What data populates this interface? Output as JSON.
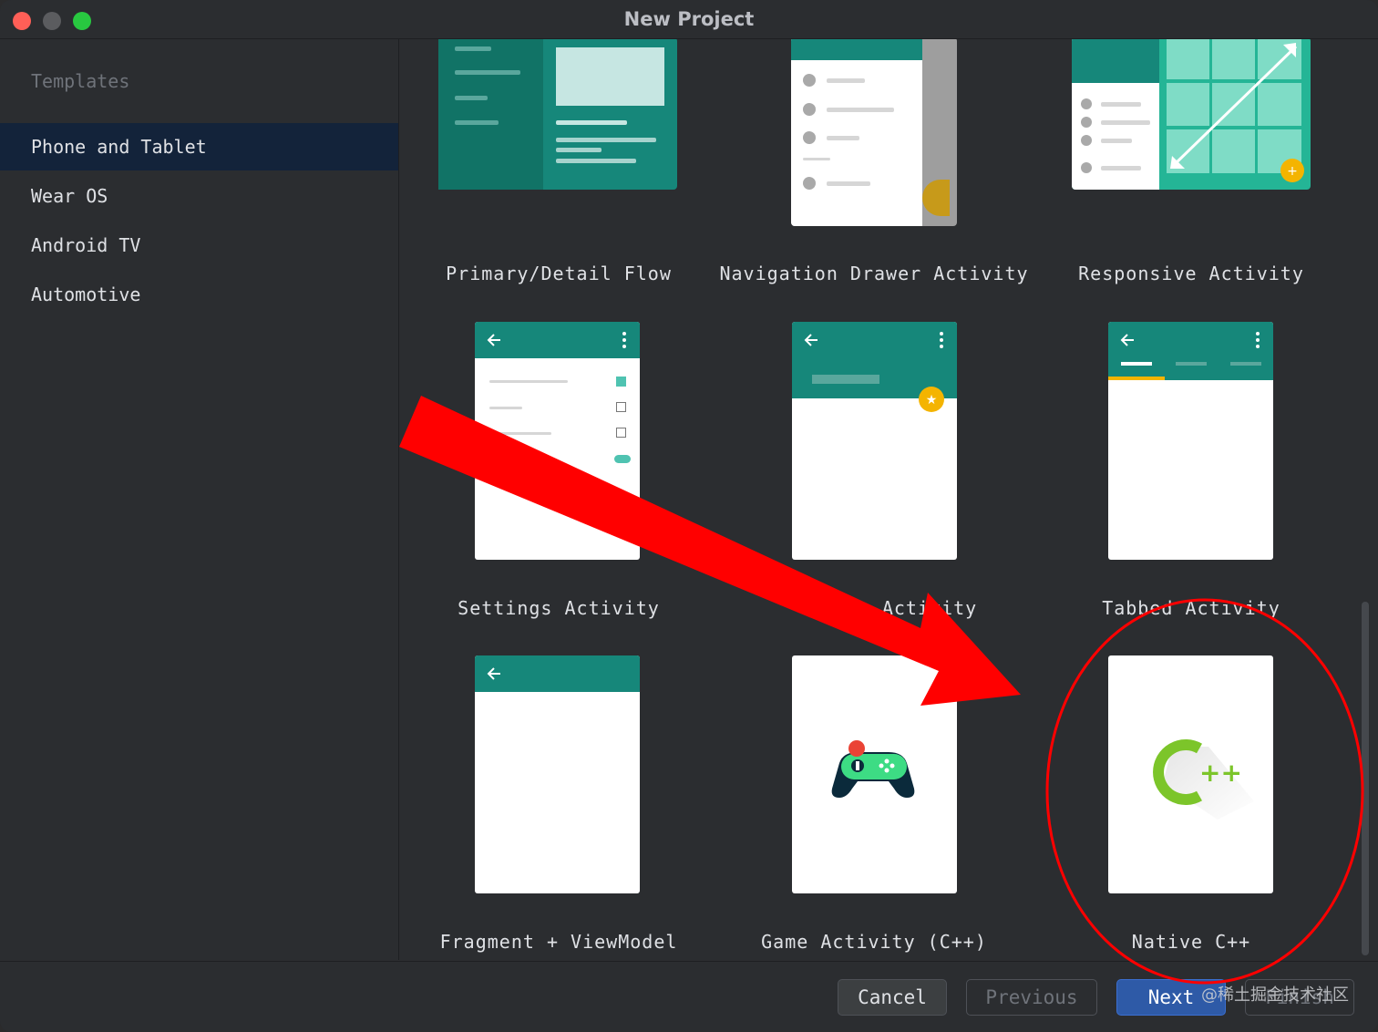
{
  "window": {
    "title": "New Project"
  },
  "sidebar": {
    "heading": "Templates",
    "items": [
      {
        "label": "Phone and Tablet",
        "selected": true
      },
      {
        "label": "Wear OS",
        "selected": false
      },
      {
        "label": "Android TV",
        "selected": false
      },
      {
        "label": "Automotive",
        "selected": false
      }
    ]
  },
  "templates": [
    {
      "label": "Primary/Detail Flow"
    },
    {
      "label": "Navigation Drawer Activity"
    },
    {
      "label": "Responsive Activity"
    },
    {
      "label": "Settings Activity"
    },
    {
      "label": "Activity"
    },
    {
      "label": "Tabbed Activity"
    },
    {
      "label": "Fragment + ViewModel"
    },
    {
      "label": "Game Activity (C++)"
    },
    {
      "label": "Native C++"
    }
  ],
  "footer": {
    "cancel": "Cancel",
    "previous": "Previous",
    "next": "Next",
    "finish": "Finish",
    "watermark": "@稀土掘金技术社区"
  },
  "colors": {
    "accent_teal": "#16877a",
    "accent_yellow": "#f4b400",
    "cpp_green": "#7cc52a",
    "annotation_red": "#ff0000",
    "next_button": "#2e5aa7"
  },
  "icons": [
    "back-arrow-icon",
    "more-vert-icon",
    "star-fab-icon",
    "plus-fab-icon",
    "gamepad-icon",
    "cpp-logo-icon"
  ]
}
